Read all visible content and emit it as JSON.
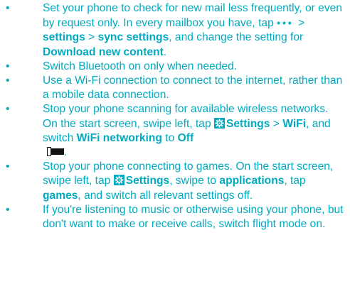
{
  "bullet": "•",
  "tips": [
    {
      "t1": "Set your phone to check for new mail less frequently, or even by request only. In every mailbox you have, tap ",
      "t2": " > ",
      "b1": "settings",
      "t3": " > ",
      "b2": "sync settings",
      "t4": ", and change the setting for ",
      "b3": "Download new content",
      "t5": "."
    },
    {
      "t1": "Switch Bluetooth on only when needed."
    },
    {
      "t1": "Use a Wi-Fi connection to connect to the internet, rather than a mobile data connection."
    },
    {
      "t1": "Stop your phone scanning for available wireless networks. On the start screen, swipe left, tap ",
      "b1": "Settings",
      "t2": " > ",
      "b2": "WiFi",
      "t3": ", and switch ",
      "b3": "WiFi networking",
      "t4": " to ",
      "b4": "Off",
      "t5": "."
    },
    {
      "t1": "Stop your phone connecting to games. On the start screen, swipe left, tap ",
      "b1": "Settings",
      "t2": ", swipe to ",
      "b2": "applications",
      "t3": ", tap ",
      "b3": "games",
      "t4": ", and switch all relevant settings off."
    },
    {
      "t1": "If you're listening to music or otherwise using your phone, but don't want to make or receive calls, switch flight mode on."
    }
  ],
  "icons": {
    "more": "ellipsis-icon",
    "settings": "settings-icon",
    "toggle": "toggle-off-icon"
  },
  "colors": {
    "text": "#00aabf",
    "icon_bg": "#00aabf",
    "toggle": "#111111"
  }
}
